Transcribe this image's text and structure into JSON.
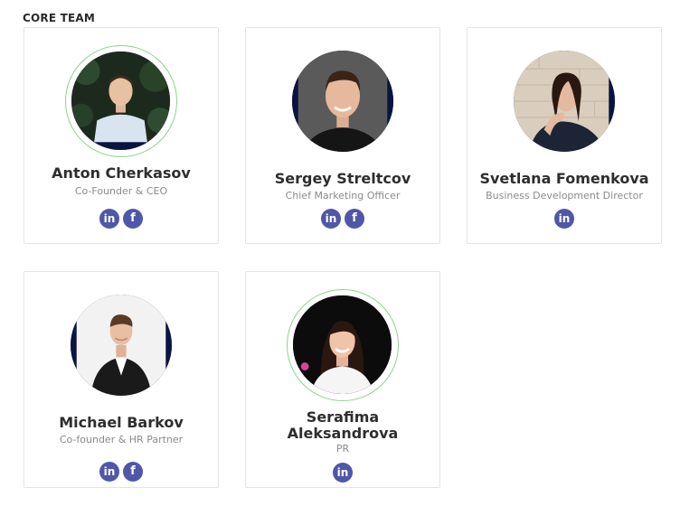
{
  "section_title": "CORE TEAM",
  "social_icons": {
    "linkedin": "in",
    "facebook": "f"
  },
  "colors": {
    "social": "#4f57a8",
    "ring": "#8fd28a",
    "photo_border": "#0a1440"
  },
  "members": [
    {
      "name": "Anton Cherkasov",
      "role": "Co-Founder & CEO",
      "socials": [
        "linkedin",
        "facebook"
      ]
    },
    {
      "name": "Sergey Streltcov",
      "role": "Chief Marketing Officer",
      "socials": [
        "linkedin",
        "facebook"
      ]
    },
    {
      "name": "Svetlana Fomenkova",
      "role": "Business Development Director",
      "socials": [
        "linkedin"
      ]
    },
    {
      "name": "Michael Barkov",
      "role": "Co-founder & HR Partner",
      "socials": [
        "linkedin",
        "facebook"
      ]
    },
    {
      "name": "Serafima Aleksandrova",
      "role": "PR",
      "socials": [
        "linkedin"
      ]
    }
  ]
}
